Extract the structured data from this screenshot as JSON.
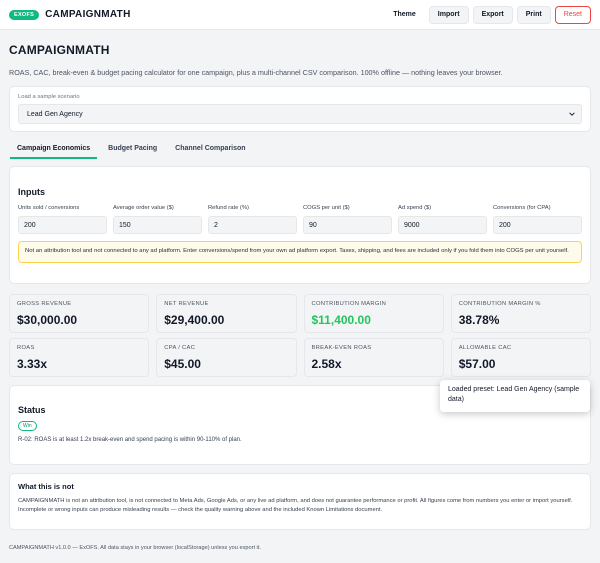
{
  "header": {
    "badge": "EXOFS",
    "brand": "CAMPAIGNMATH",
    "actions": {
      "theme": "Theme",
      "import": "Import",
      "export": "Export",
      "print": "Print",
      "reset": "Reset"
    }
  },
  "page": {
    "title": "CAMPAIGNMATH",
    "subtitle": "ROAS, CAC, break-even & budget pacing calculator for one campaign, plus a multi-channel CSV comparison. 100% offline — nothing leaves your browser."
  },
  "scenario": {
    "label": "Load a sample scenario",
    "selected": "Lead Gen Agency"
  },
  "tabs": [
    {
      "label": "Campaign Economics",
      "active": true
    },
    {
      "label": "Budget Pacing",
      "active": false
    },
    {
      "label": "Channel Comparison",
      "active": false
    }
  ],
  "inputs": {
    "heading": "Inputs",
    "fields": [
      {
        "label": "Units sold / conversions",
        "value": "200"
      },
      {
        "label": "Average order value ($)",
        "value": "150"
      },
      {
        "label": "Refund rate (%)",
        "value": "2"
      },
      {
        "label": "COGS per unit ($)",
        "value": "90"
      },
      {
        "label": "Ad spend ($)",
        "value": "9000"
      },
      {
        "label": "Conversions (for CPA)",
        "value": "200"
      }
    ],
    "notice": "Not an attribution tool and not connected to any ad platform. Enter conversions/spend from your own ad platform export. Taxes, shipping, and fees are included only if you fold them into COGS per unit yourself."
  },
  "metrics": [
    {
      "label": "GROSS REVENUE",
      "value": "$30,000.00",
      "highlight": false
    },
    {
      "label": "NET REVENUE",
      "value": "$29,400.00",
      "highlight": false
    },
    {
      "label": "CONTRIBUTION MARGIN",
      "value": "$11,400.00",
      "highlight": true
    },
    {
      "label": "CONTRIBUTION MARGIN %",
      "value": "38.78%",
      "highlight": false
    },
    {
      "label": "ROAS",
      "value": "3.33x",
      "highlight": false
    },
    {
      "label": "CPA / CAC",
      "value": "$45.00",
      "highlight": false
    },
    {
      "label": "BREAK-EVEN ROAS",
      "value": "2.58x",
      "highlight": false
    },
    {
      "label": "ALLOWABLE CAC",
      "value": "$57.00",
      "highlight": false
    }
  ],
  "status": {
    "heading": "Status",
    "badge": "Win",
    "text": "R-02: ROAS is at least 1.2x break-even and spend pacing is within 90-110% of plan."
  },
  "toast": {
    "text": "Loaded preset: Lead Gen Agency (sample data)"
  },
  "whatnot": {
    "heading": "What this is not",
    "text": "CAMPAIGNMATH is not an attribution tool, is not connected to Meta Ads, Google Ads, or any live ad platform, and does not guarantee performance or profit. All figures come from numbers you enter or import yourself. Incomplete or wrong inputs can produce misleading results — check the quality warning above and the included Known Limitations document."
  },
  "footer": {
    "text": "CAMPAIGNMATH v1.0.0 — ExOFS. All data stays in your browser (localStorage) unless you export it."
  },
  "colors": {
    "accent": "#10b981",
    "positive": "#22c55e",
    "danger": "#ef4444",
    "notice_bg": "#fffbeb",
    "notice_border": "#fcd34d"
  }
}
